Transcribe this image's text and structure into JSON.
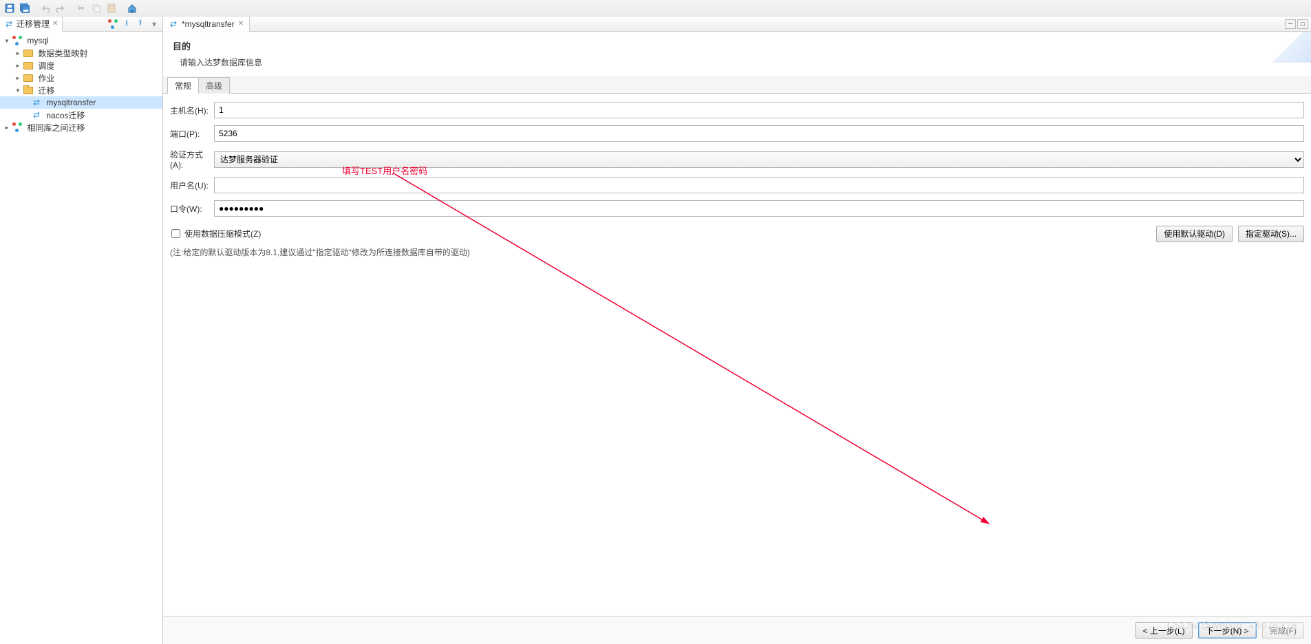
{
  "sidebar": {
    "tab_label": "迁移管理",
    "tree": {
      "root": "mysql",
      "items": [
        {
          "label": "数据类型映射",
          "type": "folder"
        },
        {
          "label": "调度",
          "type": "folder"
        },
        {
          "label": "作业",
          "type": "folder"
        },
        {
          "label": "迁移",
          "type": "folder-open",
          "children": [
            {
              "label": "mysqltransfer",
              "type": "leaf",
              "selected": true
            },
            {
              "label": "nacos迁移",
              "type": "leaf"
            }
          ]
        }
      ],
      "sibling": "相同库之间迁移"
    }
  },
  "editor": {
    "tab_label": "*mysqltransfer"
  },
  "wizard": {
    "title": "目的",
    "subtitle": "请输入达梦数据库信息",
    "tabs": {
      "general": "常规",
      "advanced": "高级"
    },
    "labels": {
      "host": "主机名(H):",
      "port": "端口(P):",
      "auth": "验证方式(A):",
      "user": "用户名(U):",
      "password": "口令(W):"
    },
    "values": {
      "host": "1",
      "port": "5236",
      "auth": "达梦服务器验证",
      "user": "",
      "password": "●●●●●●●●●"
    },
    "compress_label": "使用数据压缩模式(Z)",
    "btn_default_driver": "使用默认驱动(D)",
    "btn_specify_driver": "指定驱动(S)...",
    "note": "(注:给定的默认驱动版本为8.1,建议通过\"指定驱动\"修改为所连接数据库自带的驱动)"
  },
  "footer": {
    "back": "< 上一步(L)",
    "next": "下一步(N) >",
    "finish": "完成(F)"
  },
  "annotation": "填写TEST用户名密码",
  "watermark": "CSDN @weixin_43975316"
}
